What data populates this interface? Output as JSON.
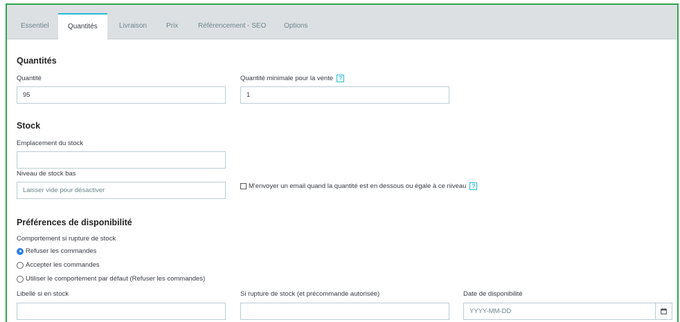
{
  "tabs": [
    {
      "label": "Essentiel",
      "active": false
    },
    {
      "label": "Quantités",
      "active": true
    },
    {
      "label": "Livraison",
      "active": false
    },
    {
      "label": "Prix",
      "active": false
    },
    {
      "label": "Référencement - SEO",
      "active": false
    },
    {
      "label": "Options",
      "active": false
    }
  ],
  "quantities": {
    "heading": "Quantités",
    "quantity_label": "Quantité",
    "quantity_value": "95",
    "min_quantity_label": "Quantité minimale pour la vente",
    "min_quantity_value": "1",
    "help_icon": "?"
  },
  "stock": {
    "heading": "Stock",
    "location_label": "Emplacement du stock",
    "location_value": "",
    "low_stock_label": "Niveau de stock bas",
    "low_stock_placeholder": "Laisser vide pour désactiver",
    "email_checkbox_label": "M'envoyer un email quand la quantité est en dessous ou égale à ce niveau",
    "email_checkbox_checked": false
  },
  "availability": {
    "heading": "Préférences de disponibilité",
    "out_of_stock_label": "Comportement si rupture de stock",
    "options": [
      {
        "label": "Refuser les commandes",
        "selected": true
      },
      {
        "label": "Accepter les commandes",
        "selected": false
      },
      {
        "label": "Utiliser le comportement par défaut (Refuser les commandes)",
        "selected": false
      }
    ],
    "in_stock_label": "Libellé si en stock",
    "in_stock_value": "",
    "backorder_label": "Si rupture de stock (et précommande autorisée)",
    "backorder_value": "",
    "date_label": "Date de disponibilité",
    "date_placeholder": "YYYY-MM-DD"
  },
  "colors": {
    "frame_border": "#2ea44f",
    "active_tab_accent": "#25b9d7",
    "radio_selected": "#2d7fe0"
  }
}
